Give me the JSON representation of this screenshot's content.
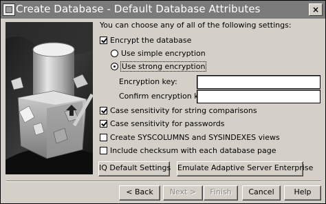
{
  "window": {
    "title": "Create Database - Default Database Attributes",
    "close_label": "×"
  },
  "intro": "You can choose any of all of the following settings:",
  "options": {
    "encrypt": {
      "label": "Encrypt the database",
      "checked": true
    },
    "simple_encryption": {
      "label": "Use simple encryption",
      "selected": false
    },
    "strong_encryption": {
      "label": "Use strong encryption",
      "selected": true
    },
    "case_string": {
      "label": "Case sensitivity for string comparisons",
      "checked": true
    },
    "case_password": {
      "label": "Case sensitivity for passwords",
      "checked": true
    },
    "syscolumns": {
      "label": "Create SYSCOLUMNS and SYSINDEXES views",
      "checked": false
    },
    "checksum": {
      "label": "Include checksum with each database page",
      "checked": false
    }
  },
  "fields": {
    "encryption_key": {
      "label": "Encryption key:",
      "value": ""
    },
    "confirm_key": {
      "label": "Confirm encryption key:",
      "value": ""
    }
  },
  "buttons": {
    "iq_defaults": "IQ Default Settings",
    "emulate_ase": "Emulate Adaptive Server Enterprise",
    "back": "< Back",
    "next": "Next >",
    "finish": "Finish",
    "cancel": "Cancel",
    "help": "Help"
  }
}
